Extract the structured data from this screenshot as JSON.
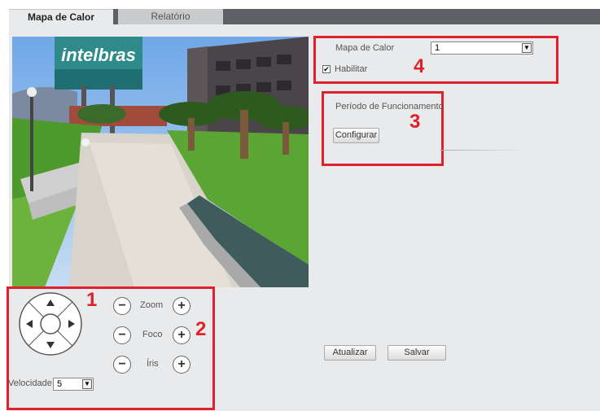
{
  "tabs": [
    {
      "label": "Mapa de Calor",
      "active": true
    },
    {
      "label": "Relatório",
      "active": false
    }
  ],
  "video": {
    "sign_text": "intelbras"
  },
  "heatmap": {
    "label": "Mapa de Calor",
    "value": "1",
    "enable_label": "Habilitar",
    "enabled": true
  },
  "period": {
    "label": "Período de Funcionamento",
    "configure_button": "Configurar"
  },
  "ptz": {
    "zoom_label": "Zoom",
    "focus_label": "Foco",
    "iris_label": "Íris",
    "minus": "−",
    "plus": "+",
    "speed_label": "Velocidade",
    "speed_value": "5"
  },
  "actions": {
    "refresh": "Atualizar",
    "save": "Salvar"
  },
  "markers": [
    "1",
    "2",
    "3",
    "4"
  ],
  "colors": {
    "marker_red": "#e0202a",
    "panel_bg": "#e9eaeb",
    "tab_strip": "#5e6066"
  }
}
